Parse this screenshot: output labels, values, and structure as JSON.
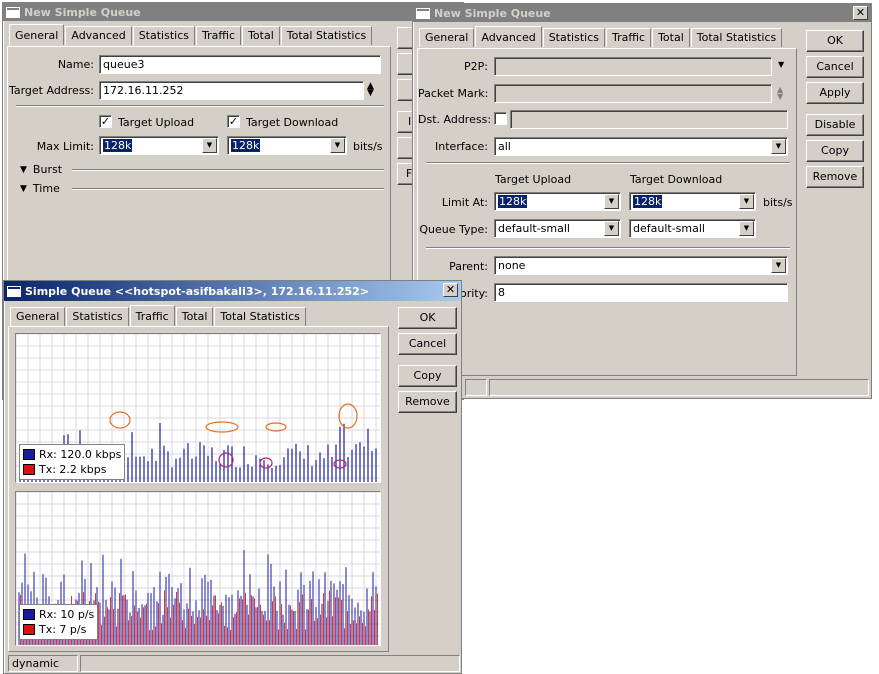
{
  "win1": {
    "title": "New Simple Queue",
    "tabs": [
      "General",
      "Advanced",
      "Statistics",
      "Traffic",
      "Total",
      "Total Statistics"
    ],
    "name_label": "Name:",
    "name_value": "queue3",
    "target_label": "Target Address:",
    "target_value": "172.16.11.252",
    "target_upload_label": "Target Upload",
    "target_download_label": "Target Download",
    "target_upload_checked": true,
    "target_download_checked": true,
    "max_limit_label": "Max Limit:",
    "max_limit_upload": "128k",
    "max_limit_download": "128k",
    "units": "bits/s",
    "burst_label": "Burst",
    "time_label": "Time",
    "side_buttons": [
      "",
      "",
      "",
      "I",
      "",
      "F"
    ]
  },
  "win2": {
    "title": "New Simple Queue",
    "tabs": [
      "General",
      "Advanced",
      "Statistics",
      "Traffic",
      "Total",
      "Total Statistics"
    ],
    "p2p_label": "P2P:",
    "packet_mark_label": "Packet Mark:",
    "dst_address_label": "Dst. Address:",
    "interface_label": "Interface:",
    "interface_value": "all",
    "target_upload_header": "Target Upload",
    "target_download_header": "Target Download",
    "limit_at_label": "Limit At:",
    "limit_at_upload": "128k",
    "limit_at_download": "128k",
    "units": "bits/s",
    "queue_type_label": "Queue Type:",
    "queue_type_upload": "default-small",
    "queue_type_download": "default-small",
    "parent_label": "Parent:",
    "parent_value": "none",
    "priority_label": "iority:",
    "priority_value": "8",
    "buttons": {
      "ok": "OK",
      "cancel": "Cancel",
      "apply": "Apply",
      "disable": "Disable",
      "copy": "Copy",
      "remove": "Remove"
    }
  },
  "win3": {
    "title": "Simple Queue <<hotspot-asifbakali3>, 172.16.11.252>",
    "tabs": [
      "General",
      "Statistics",
      "Traffic",
      "Total",
      "Total Statistics"
    ],
    "buttons": {
      "ok": "OK",
      "cancel": "Cancel",
      "copy": "Copy",
      "remove": "Remove"
    },
    "graph1_legend": {
      "rx": "Rx: 120.0 kbps",
      "tx": "Tx: 2.2 kbps"
    },
    "graph2_legend": {
      "rx": "Rx: 10 p/s",
      "tx": "Tx: 7 p/s"
    },
    "status": "dynamic",
    "colors": {
      "rx": "#1a1aa0",
      "tx": "#e01010",
      "annotation": "#e07020",
      "annotation2": "#c02080"
    }
  }
}
